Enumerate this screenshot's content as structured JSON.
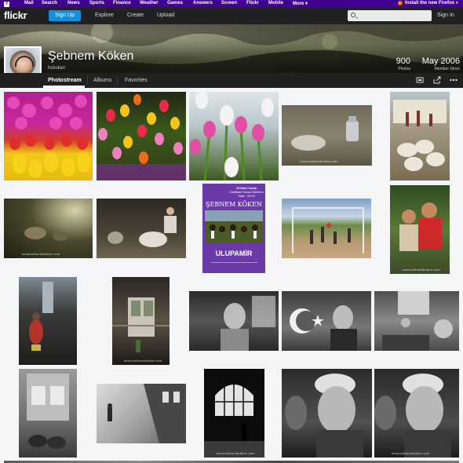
{
  "yahoo_bar": {
    "items": [
      "Mail",
      "Search",
      "News",
      "Sports",
      "Finance",
      "Weather",
      "Games",
      "Answers",
      "Screen",
      "Flickr",
      "Mobile",
      "More"
    ],
    "more_arrow": "▾",
    "firefox_promo": "Install the new Firefox »"
  },
  "nav": {
    "logo": "flickr",
    "signup": "Sign Up",
    "links": [
      "Explore",
      "Create",
      "Upload"
    ],
    "search_placeholder": "",
    "signin": "Sign In"
  },
  "profile": {
    "name": "Şebnem Köken",
    "username": "hckoken",
    "photos_value": "900",
    "photos_label": "Photos",
    "since_value": "May 2006",
    "since_label": "Member Since"
  },
  "tabs": {
    "photostream": "Photostream",
    "albums": "Albums",
    "favorites": "Favorites"
  },
  "poster": {
    "date_line": "13 Mart Cuma",
    "venue_line": "Gediksizi Sanat Merkezi",
    "time_line": "Saat : 19.00",
    "name": "ŞEBNEM KÖKEN",
    "title": "ULUPAMİR"
  },
  "colors": {
    "yahoo_purple": "#400090",
    "flickr_dark": "#212124",
    "signup_blue": "#128fdc",
    "poster_purple": "#6a3aa8"
  },
  "icons": [
    "search-icon",
    "slideshow-icon",
    "share-icon",
    "more-icon",
    "firefox-icon",
    "yahoo-logo-icon"
  ],
  "photos": [
    {
      "name": "tulips-pink-yellow"
    },
    {
      "name": "tulips-colorful-garden"
    },
    {
      "name": "tulips-from-below"
    },
    {
      "name": "sleeping-man-and-can"
    },
    {
      "name": "sheep-herd-village"
    },
    {
      "name": "sheep-in-forest"
    },
    {
      "name": "man-shearing-sheep"
    },
    {
      "name": "ulupamir-poster"
    },
    {
      "name": "football-goal-children"
    },
    {
      "name": "two-boys-portrait"
    },
    {
      "name": "girl-red-dress-alley"
    },
    {
      "name": "interior-courtyard"
    },
    {
      "name": "boy-bw-portrait"
    },
    {
      "name": "boy-with-flag"
    },
    {
      "name": "kids-on-steps"
    },
    {
      "name": "train-window-women"
    },
    {
      "name": "train-platform-walker"
    },
    {
      "name": "arched-window-silhouette"
    },
    {
      "name": "man-profile-bw-1"
    },
    {
      "name": "man-profile-bw-2"
    }
  ]
}
